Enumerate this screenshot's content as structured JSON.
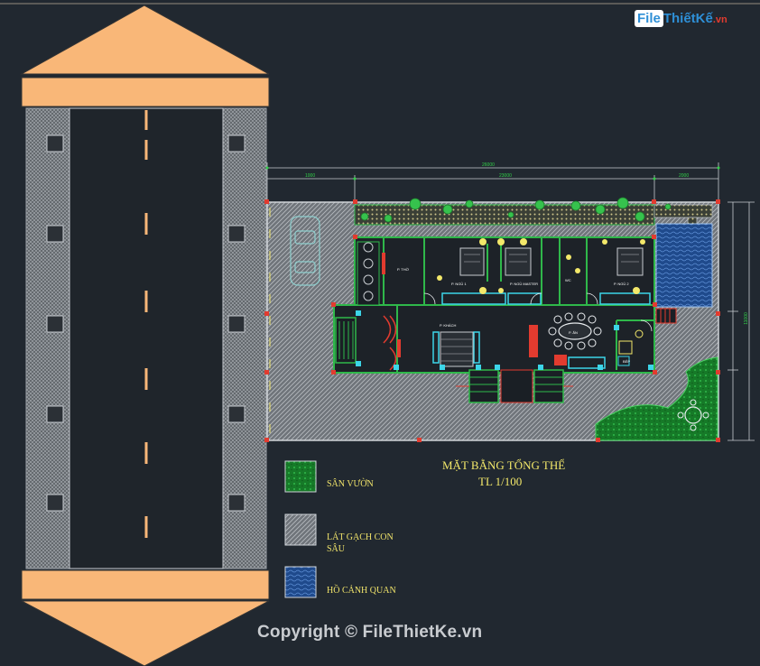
{
  "logo": {
    "file": "File",
    "rest": "ThiếtKế",
    "tld": ".vn"
  },
  "plan": {
    "title_line1": "MẶT BẰNG TỔNG THỂ",
    "title_line2": "TL 1/100"
  },
  "legend": [
    {
      "label": "SÂN VƯỜN",
      "color": "#1a8a2e",
      "pattern": "garden"
    },
    {
      "label": "LÁT GẠCH CON SÂU",
      "color": "#8c9096",
      "pattern": "paving"
    },
    {
      "label": "HỒ CẢNH QUAN",
      "color": "#2556a8",
      "pattern": "water"
    }
  ],
  "dimensions": {
    "overall": "26000",
    "seg_left": "1000",
    "seg_mid": "23000",
    "seg_right": "2000",
    "side": "11000"
  },
  "rooms": {
    "bed1": "P. NGỦ 1",
    "bed_master": "P. NGỦ MASTER",
    "bed2": "P. NGỦ 2",
    "wc": "WC",
    "living": "P. KHÁCH",
    "dining": "P. ĂN",
    "kitchen": "BẾP",
    "worship": "P. THỜ"
  },
  "watermark": "Copyright © FileThietKe.vn",
  "colors": {
    "background": "#212830",
    "accent_orange": "#f9b778",
    "line_yellow": "#f3e86a",
    "paving": "#8c9096",
    "garden": "#1a8a2e",
    "water": "#2556a8"
  }
}
